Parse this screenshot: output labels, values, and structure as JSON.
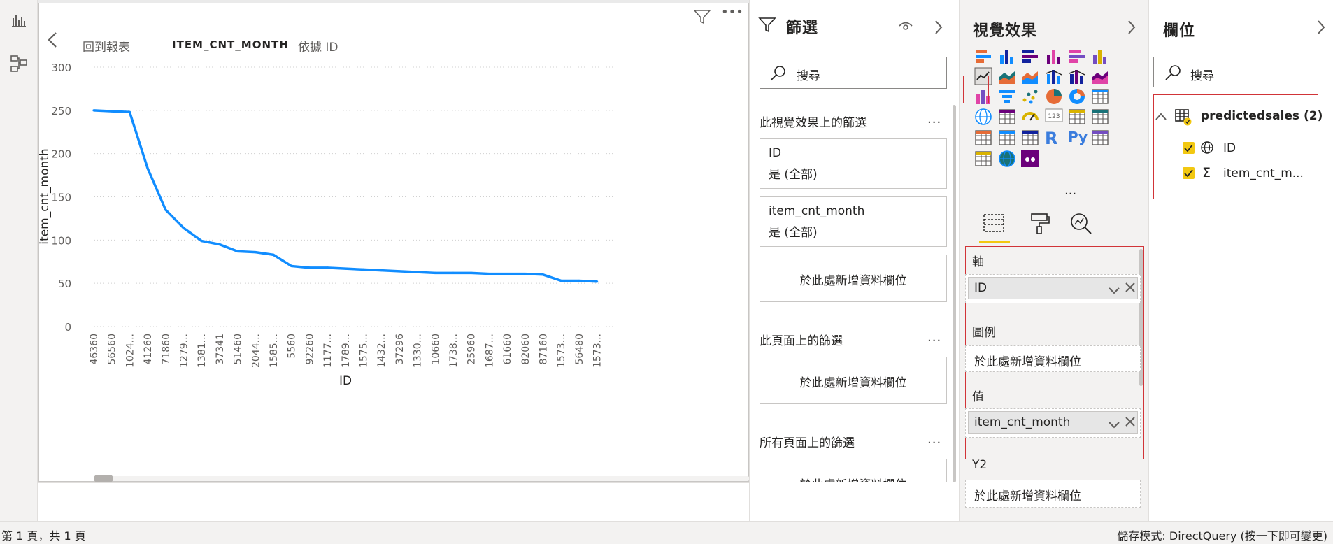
{
  "header": {
    "back_label": "回到報表",
    "visual_title": "ITEM_CNT_MONTH",
    "drill_label": "依據 ID"
  },
  "chart_data": {
    "type": "line",
    "xlabel": "ID",
    "ylabel": "item_cnt_month",
    "ylim": [
      0,
      300
    ],
    "yticks": [
      0,
      50,
      100,
      150,
      200,
      250,
      300
    ],
    "color": "#118DFF",
    "categories": [
      "46360",
      "56560",
      "1024...",
      "41260",
      "71860",
      "1279...",
      "1381...",
      "37341",
      "51460",
      "2044...",
      "1585...",
      "5560",
      "92260",
      "1177...",
      "1789...",
      "1575...",
      "1432...",
      "37296",
      "1330...",
      "10660",
      "1738...",
      "25960",
      "1687...",
      "61660",
      "82060",
      "87160",
      "1573...",
      "56480",
      "1573..."
    ],
    "values": [
      250,
      249,
      248,
      183,
      135,
      114,
      99,
      95,
      87,
      86,
      83,
      70,
      68,
      68,
      67,
      66,
      65,
      64,
      63,
      62,
      62,
      62,
      61,
      61,
      61,
      60,
      53,
      53,
      52
    ]
  },
  "filters": {
    "title": "篩選",
    "search_placeholder": "搜尋",
    "visual_section": "此視覺效果上的篩選",
    "cards": [
      {
        "name": "ID",
        "value": "是 (全部)"
      },
      {
        "name": "item_cnt_month",
        "value": "是 (全部)"
      }
    ],
    "add_field": "於此處新增資料欄位",
    "page_section": "此頁面上的篩選",
    "all_pages_section": "所有頁面上的篩選",
    "more": "..."
  },
  "viz": {
    "title": "視覺效果",
    "more_label": "...",
    "wells": {
      "axis_title": "軸",
      "axis_field": "ID",
      "legend_title": "圖例",
      "values_title": "值",
      "values_field": "item_cnt_month",
      "y2_title": "Y2",
      "add_field": "於此處新增資料欄位"
    },
    "r_label": "R",
    "py_label": "Py",
    "num_label": "123"
  },
  "fields": {
    "title": "欄位",
    "search_placeholder": "搜尋",
    "table_name": "predictedsales (2)",
    "items": [
      "ID",
      "item_cnt_m..."
    ]
  },
  "status": {
    "page": "第 1 頁，共 1 頁",
    "storage": "儲存模式: DirectQuery (按一下即可變更)"
  }
}
